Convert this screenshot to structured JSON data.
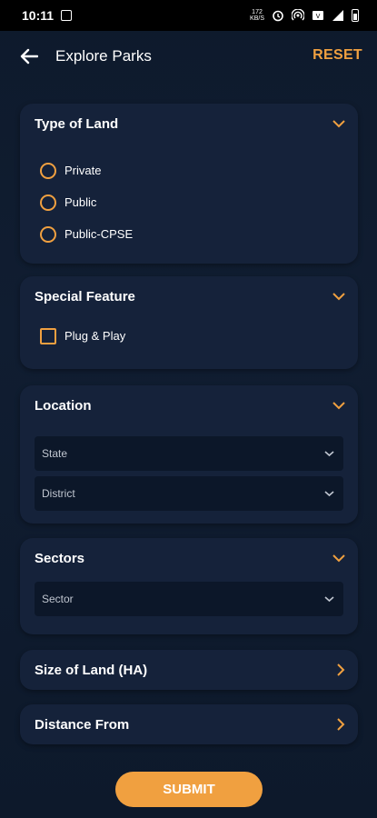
{
  "status_bar": {
    "time": "10:11",
    "speed": "172\nKB/S"
  },
  "header": {
    "title": "Explore Parks",
    "reset_label": "RESET"
  },
  "type_of_land": {
    "title": "Type of Land",
    "options": [
      "Private",
      "Public",
      "Public-CPSE"
    ]
  },
  "special_feature": {
    "title": "Special Feature",
    "options": [
      "Plug & Play"
    ]
  },
  "location": {
    "title": "Location",
    "state_label": "State",
    "district_label": "District"
  },
  "sectors": {
    "title": "Sectors",
    "sector_label": "Sector"
  },
  "size_of_land": {
    "title": "Size of Land (HA)"
  },
  "distance_from": {
    "title": "Distance From"
  },
  "submit_label": "SUBMIT",
  "colors": {
    "accent": "#f0a040",
    "card": "#15223a",
    "background": "#0e1a2c"
  }
}
